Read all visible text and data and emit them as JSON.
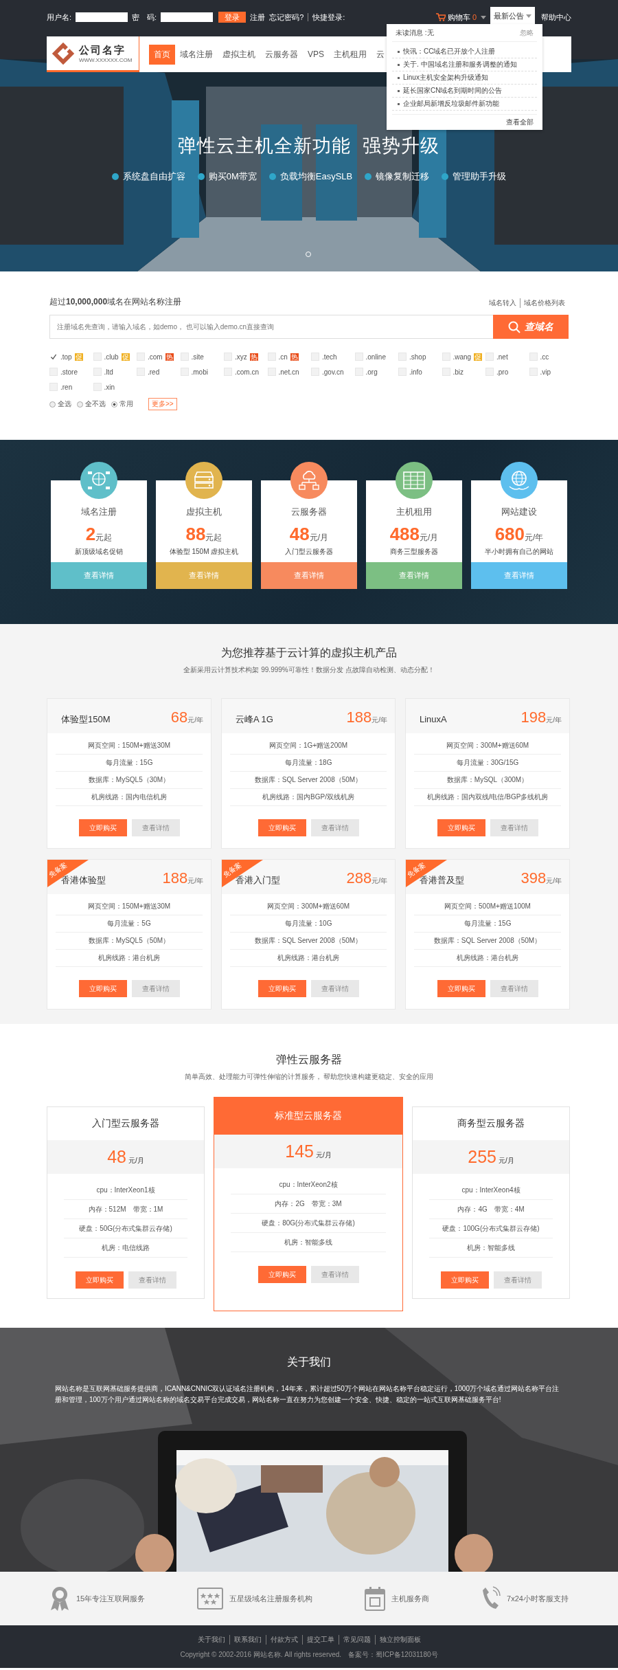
{
  "top_bar": {
    "username_label": "用户名:",
    "password_label": "密　码:",
    "login_button": "登录",
    "register": "注册",
    "forgot": "忘记密码?",
    "quick_login": "快捷登录:",
    "cart": {
      "label": "购物车",
      "count": "0"
    },
    "notice_menu": {
      "label": "最新公告",
      "expanded": true
    },
    "help": "帮助中心"
  },
  "notice_dropdown": {
    "unread": "未读消息 :无",
    "ignore": "忽略",
    "items": [
      "快讯：CC域名已开放个人注册",
      "关于. 中国域名注册和服务调整的通知",
      "Linux主机安全架构升级通知",
      "延长国家CN域名到期时间的公告",
      "企业邮局新增反垃圾邮件新功能"
    ],
    "view_all": "查看全部"
  },
  "nav": {
    "logo": {
      "name": "公司名字",
      "url": "WWW.XXXXXX.COM"
    },
    "items": [
      {
        "label": "首页",
        "selected": true
      },
      {
        "label": "域名注册",
        "selected": false
      },
      {
        "label": "虚拟主机",
        "selected": false
      },
      {
        "label": "云服务器",
        "selected": false
      },
      {
        "label": "VPS",
        "selected": false
      },
      {
        "label": "主机租用",
        "selected": false
      },
      {
        "label": "云",
        "selected": false
      }
    ]
  },
  "hero": {
    "headline": "弹性云主机全新功能  强势升级",
    "features": [
      "系统盘自由扩容",
      "购买0M带宽",
      "负载均衡EasySLB",
      "镜像复制迁移",
      "管理助手升级"
    ]
  },
  "domain": {
    "headline": "超过**10,000,000**域名在网站名称注册",
    "links": [
      "域名转入",
      "域名价格列表"
    ],
    "search": {
      "placeholder": "注册域名先查询，请输入域名，如demo， 也可以输入demo.cn直接查询",
      "button": "查域名"
    },
    "suffixes": [
      {
        "label": ".top",
        "checked": true,
        "tag": {
          "text": "促",
          "kind": "promo"
        }
      },
      {
        "label": ".club",
        "checked": false,
        "tag": {
          "text": "促",
          "kind": "promo"
        }
      },
      {
        "label": ".com",
        "checked": false,
        "tag": {
          "text": "热",
          "kind": "hot"
        }
      },
      {
        "label": ".site",
        "checked": false
      },
      {
        "label": ".xyz",
        "checked": false,
        "tag": {
          "text": "热",
          "kind": "hot"
        }
      },
      {
        "label": ".cn",
        "checked": false,
        "tag": {
          "text": "热",
          "kind": "hot"
        }
      },
      {
        "label": ".tech",
        "checked": false
      },
      {
        "label": ".online",
        "checked": false
      },
      {
        "label": ".shop",
        "checked": false
      },
      {
        "label": ".wang",
        "checked": false,
        "tag": {
          "text": "促",
          "kind": "promo"
        }
      },
      {
        "label": ".net",
        "checked": false
      },
      {
        "label": ".cc",
        "checked": false
      },
      {
        "label": ".store",
        "checked": false
      },
      {
        "label": ".ltd",
        "checked": false
      },
      {
        "label": ".red",
        "checked": false
      },
      {
        "label": ".mobi",
        "checked": false
      },
      {
        "label": ".com.cn",
        "checked": false
      },
      {
        "label": ".net.cn",
        "checked": false
      },
      {
        "label": ".gov.cn",
        "checked": false
      },
      {
        "label": ".org",
        "checked": false
      },
      {
        "label": ".info",
        "checked": false
      },
      {
        "label": ".biz",
        "checked": false
      },
      {
        "label": ".pro",
        "checked": false
      },
      {
        "label": ".vip",
        "checked": false
      },
      {
        "label": ".ren",
        "checked": false
      },
      {
        "label": ".xin",
        "checked": false
      }
    ],
    "select_modes": [
      {
        "label": "全选",
        "selected": false
      },
      {
        "label": "全不选",
        "selected": false
      },
      {
        "label": "常用",
        "selected": true
      }
    ],
    "more": "更多>>"
  },
  "services": [
    {
      "kind": "www",
      "title": "域名注册",
      "price": "2",
      "unit": "元起",
      "note": "新顶级域名促销",
      "button": "查看详情",
      "color": "#5fbfc9"
    },
    {
      "kind": "server",
      "title": "虚拟主机",
      "price": "88",
      "unit": "元起",
      "note": "体验型 150M 虚拟主机",
      "button": "查看详情",
      "color": "#e1b44e"
    },
    {
      "kind": "cloud",
      "title": "云服务器",
      "price": "48",
      "unit": "元/月",
      "note": "入门型云服务器",
      "button": "查看详情",
      "color": "#f78a5e"
    },
    {
      "kind": "rack",
      "title": "主机租用",
      "price": "488",
      "unit": "元/月",
      "note": "商务三型服务器",
      "button": "查看详情",
      "color": "#7cbf83"
    },
    {
      "kind": "globe",
      "title": "网站建设",
      "price": "680",
      "unit": "元/年",
      "note": "半小时拥有自己的网站",
      "button": "查看详情",
      "color": "#5dbfee"
    }
  ],
  "products": {
    "title": "为您推荐基于云计算的虚拟主机产品",
    "subtitle": "全新采用云计算技术构架 99.999%可靠性！数据分发 点故障自动检测、动态分配！",
    "plans": [
      {
        "name": "体验型150M",
        "price": "68",
        "unit": "元/年",
        "specs": [
          "网页空间：150M+赠送30M",
          "每月流量：15G",
          "数据库：MySQL5（30M）",
          "机房线路：国内电信机房"
        ],
        "buy": "立即购买",
        "details": "查看详情"
      },
      {
        "name": "云峰A 1G",
        "price": "188",
        "unit": "元/年",
        "specs": [
          "网页空间：1G+赠送200M",
          "每月流量：18G",
          "数据库：SQL Server 2008（50M）",
          "机房线路：国内BGP/双线机房"
        ],
        "buy": "立即购买",
        "details": "查看详情"
      },
      {
        "name": "LinuxA",
        "price": "198",
        "unit": "元/年",
        "specs": [
          "网页空间：300M+赠送60M",
          "每月流量：30G/15G",
          "数据库：MySQL（300M）",
          "机房线路：国内双线/电信/BGP多线机房"
        ],
        "buy": "立即购买",
        "details": "查看详情"
      },
      {
        "name": "香港体验型",
        "badge": "免备案",
        "price": "188",
        "unit": "元/年",
        "specs": [
          "网页空间：150M+赠送30M",
          "每月流量：5G",
          "数据库：MySQL5（50M）",
          "机房线路：港台机房"
        ],
        "buy": "立即购买",
        "details": "查看详情"
      },
      {
        "name": "香港入门型",
        "badge": "免备案",
        "price": "288",
        "unit": "元/年",
        "specs": [
          "网页空间：300M+赠送60M",
          "每月流量：10G",
          "数据库：SQL Server 2008（50M）",
          "机房线路：港台机房"
        ],
        "buy": "立即购买",
        "details": "查看详情"
      },
      {
        "name": "香港普及型",
        "badge": "免备案",
        "price": "398",
        "unit": "元/年",
        "specs": [
          "网页空间：500M+赠送100M",
          "每月流量：15G",
          "数据库：SQL Server 2008（50M）",
          "机房线路：港台机房"
        ],
        "buy": "立即购买",
        "details": "查看详情"
      }
    ]
  },
  "cloud": {
    "title": "弹性云服务器",
    "subtitle": "简单高效、处理能力可弹性伸缩的计算服务， 帮助您快速构建更稳定、安全的应用",
    "plans": [
      {
        "name": "入门型云服务器",
        "featured": false,
        "price": "48",
        "unit": "元/月",
        "specs": [
          "cpu：InterXeon1核",
          "内存：512M　带宽：1M",
          "硬盘：50G(分布式集群云存储)",
          "机房：电信线路"
        ],
        "buy": "立即购买",
        "details": "查看详情"
      },
      {
        "name": "标准型云服务器",
        "featured": true,
        "price": "145",
        "unit": "元/月",
        "specs": [
          "cpu：InterXeon2核",
          "内存：2G　带宽：3M",
          "硬盘：80G(分布式集群云存储)",
          "机房：智能多线"
        ],
        "buy": "立即购买",
        "details": "查看详情"
      },
      {
        "name": "商务型云服务器",
        "featured": false,
        "price": "255",
        "unit": "元/月",
        "specs": [
          "cpu：InterXeon4核",
          "内存：4G　带宽：4M",
          "硬盘：100G(分布式集群云存储)",
          "机房：智能多线"
        ],
        "buy": "立即购买",
        "details": "查看详情"
      }
    ]
  },
  "about": {
    "title": "关于我们",
    "text": "网站名称是互联网基础服务提供商，ICANN&CNNIC双认证域名注册机构，14年来，累计超过50万个网站在网站名称平台稳定运行，1000万个域名通过网站名称平台注册和管理，100万个用户通过网站名称的域名交易平台完成交易，网站名称一直在努力为您创建一个安全、快捷、稳定的一站式互联网基础服务平台!"
  },
  "features": [
    {
      "kind": "medal",
      "text": "15年专注互联网服务"
    },
    {
      "kind": "stars",
      "text": "五星级域名注册服务机构"
    },
    {
      "kind": "calendar",
      "text": "主机服务商"
    },
    {
      "kind": "phone",
      "text": "7x24小时客服支持"
    }
  ],
  "footer": {
    "links": [
      "关于我们",
      "联系我们",
      "付款方式",
      "提交工单",
      "常见问题",
      "独立控制面板"
    ],
    "copyright": "Copyright © 2002-2016 网站名称. All rights reserved.　备案号：蜀ICP备12031180号"
  }
}
